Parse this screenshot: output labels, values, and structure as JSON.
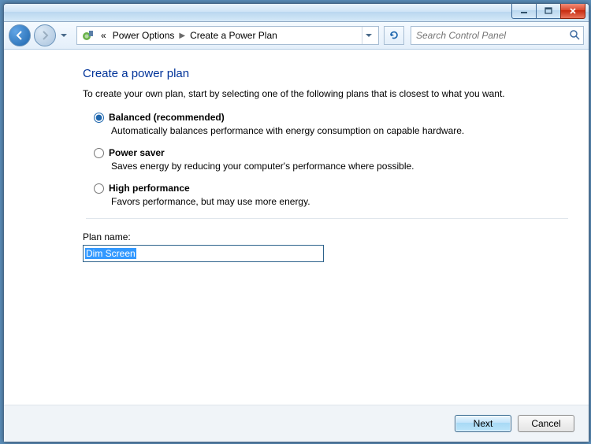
{
  "breadcrumbs": {
    "root_sep": "«",
    "item1": "Power Options",
    "item2": "Create a Power Plan"
  },
  "search": {
    "placeholder": "Search Control Panel"
  },
  "page": {
    "title": "Create a power plan",
    "intro": "To create your own plan, start by selecting one of the following plans that is closest to what you want."
  },
  "options": {
    "balanced": {
      "label": "Balanced (recommended)",
      "desc": "Automatically balances performance with energy consumption on capable hardware."
    },
    "saver": {
      "label": "Power saver",
      "desc": "Saves energy by reducing your computer's performance where possible."
    },
    "high": {
      "label": "High performance",
      "desc": "Favors performance, but may use more energy."
    }
  },
  "plan": {
    "label": "Plan name:",
    "value": "Dim Screen"
  },
  "buttons": {
    "next": "Next",
    "cancel": "Cancel"
  }
}
